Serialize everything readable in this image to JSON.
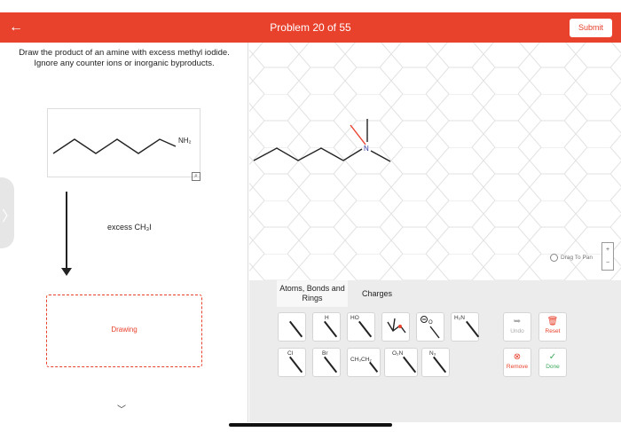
{
  "header": {
    "back_label": "←",
    "title": "Problem 20 of 55",
    "submit_label": "Submit"
  },
  "instructions": {
    "line1": "Draw the product of an amine with excess methyl iodide.",
    "line2": "Ignore any counter ions or inorganic byproducts."
  },
  "reactant": {
    "nh2_label": "NH₂"
  },
  "reagent": "excess CH₃I",
  "drawing_box_label": "Drawing",
  "canvas": {
    "n_label": "N",
    "drag_to_pan": "Drag To Pan",
    "zoom_in": "+",
    "zoom_out": "−"
  },
  "toolbar": {
    "tabs": [
      "Atoms, Bonds and Rings",
      "Charges"
    ],
    "tools_row1": [
      "",
      "H",
      "HO",
      "",
      "",
      "H₂N"
    ],
    "tools_row2": [
      "Cl",
      "Br",
      "CH₃CH₂",
      "O₂N",
      "N₃"
    ],
    "undo": "Undo",
    "reset": "Reset",
    "remove": "Remove",
    "done": "Done"
  },
  "colors": {
    "accent": "#e8412c",
    "done_green": "#3aa85a"
  }
}
